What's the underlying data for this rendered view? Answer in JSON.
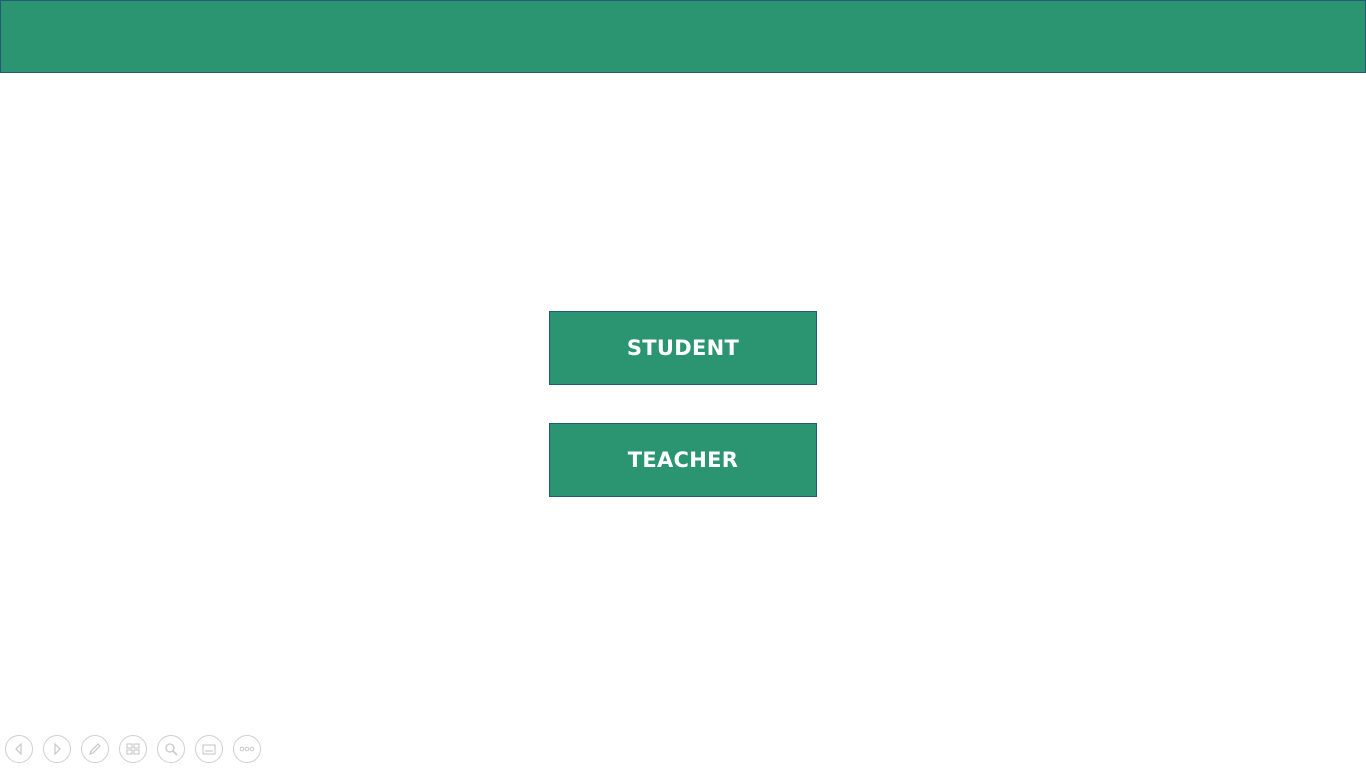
{
  "colors": {
    "accent": "#2b9572",
    "border": "#25597a",
    "button_text": "#ffffff",
    "toolbar_icon": "#c8c8c8"
  },
  "roles": {
    "student_label": "STUDENT",
    "teacher_label": "TEACHER"
  },
  "toolbar": {
    "icons": [
      "previous-slide-icon",
      "next-slide-icon",
      "pen-icon",
      "see-all-slides-icon",
      "zoom-icon",
      "subtitles-icon",
      "more-options-icon"
    ]
  }
}
